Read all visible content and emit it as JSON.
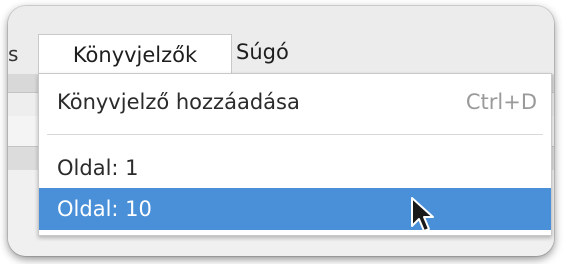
{
  "menubar": {
    "left_edge_glyph": "s",
    "bookmarks_label": "Könyvjelzők",
    "help_label": "Súgó"
  },
  "bookmarks_menu": {
    "items": [
      {
        "label": "Könyvjelző hozzáadása",
        "shortcut": "Ctrl+D"
      },
      {
        "label": "Oldal: 1"
      },
      {
        "label": "Oldal: 10",
        "highlighted": true
      }
    ]
  },
  "background": {
    "right_edge_glyph": "⊕"
  },
  "colors": {
    "highlight": "#4a90d9",
    "menu_background": "#ffffff",
    "shortcut_text": "#9a9a9a"
  },
  "icons": {
    "pointer": "mouse-pointer-icon"
  }
}
